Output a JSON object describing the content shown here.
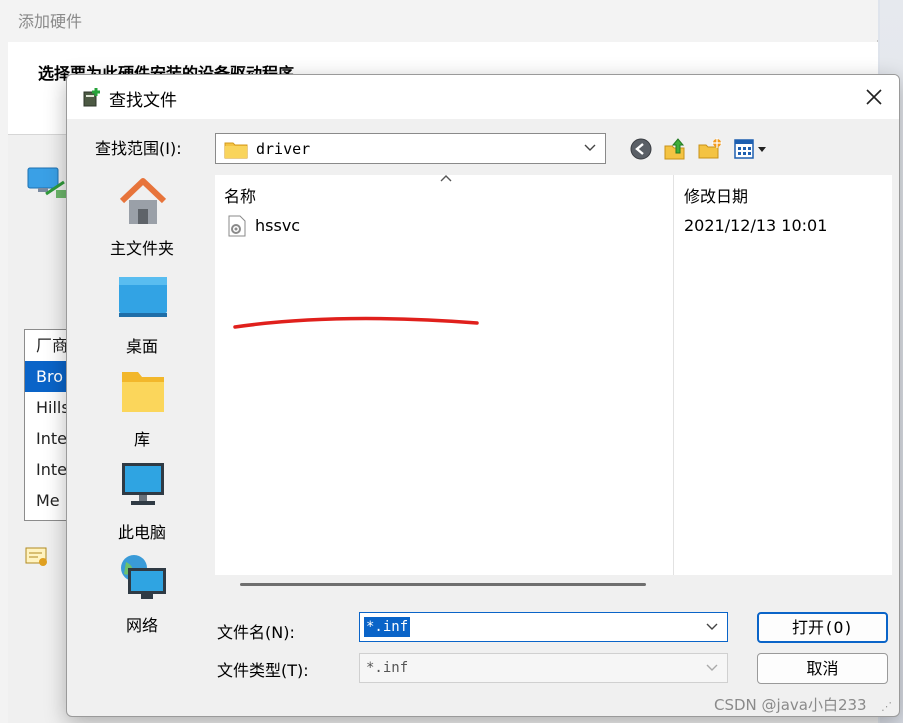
{
  "background_window": {
    "title": "添加硬件",
    "heading": "选择要为此硬件安装的设备驱动程序",
    "list_items": [
      "厂商",
      "Bro",
      "Hills",
      "Inte",
      "Inte",
      "Me"
    ]
  },
  "dialog": {
    "title": "查找文件",
    "look_in_label": "查找范围(I):",
    "look_in_value": "driver",
    "places": [
      {
        "label": "主文件夹",
        "icon": "home-icon"
      },
      {
        "label": "桌面",
        "icon": "desktop-icon"
      },
      {
        "label": "库",
        "icon": "library-folder-icon"
      },
      {
        "label": "此电脑",
        "icon": "computer-icon"
      },
      {
        "label": "网络",
        "icon": "network-icon"
      }
    ],
    "columns": {
      "name": "名称",
      "date": "修改日期"
    },
    "files": [
      {
        "name": "hssvc",
        "modified": "2021/12/13 10:01",
        "icon": "setup-file-icon"
      }
    ],
    "file_name_label": "文件名(N):",
    "file_name_value": "*.inf",
    "file_type_label": "文件类型(T):",
    "file_type_value": "*.inf",
    "open_button": "打开(O)",
    "cancel_button": "取消"
  },
  "watermark": "CSDN @java小白233",
  "colors": {
    "accent": "#0a64c8",
    "annotation": "#e0201c"
  }
}
